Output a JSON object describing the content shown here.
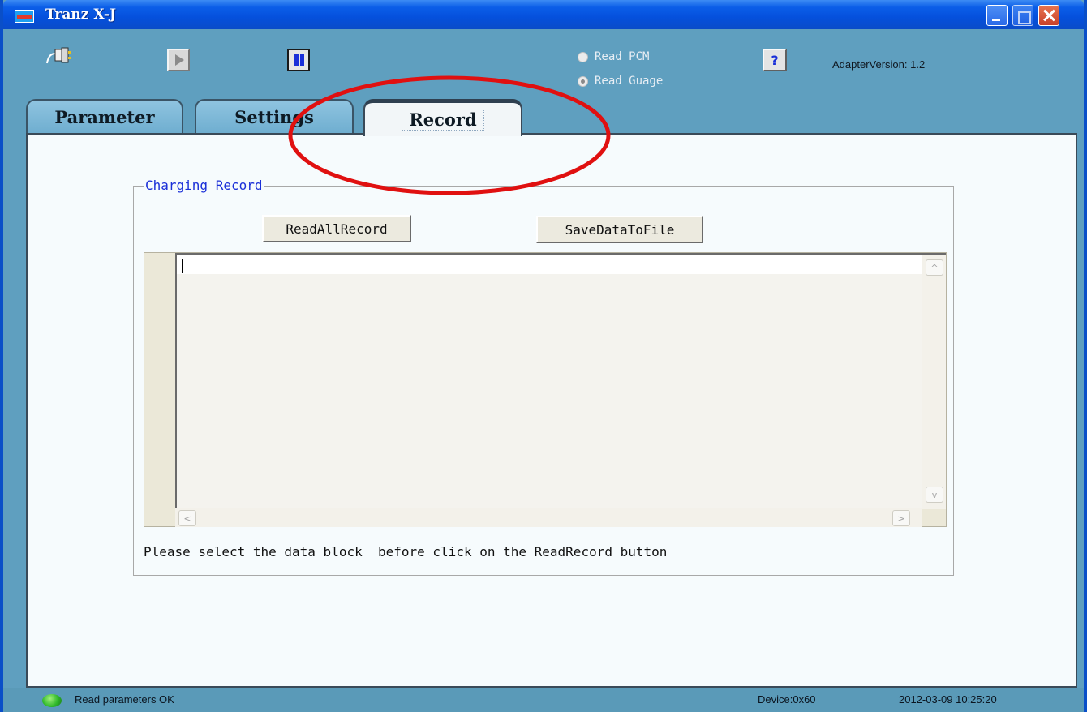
{
  "window": {
    "title": "Tranz X-J"
  },
  "toolbar": {
    "connect_icon": "connect-plug-icon",
    "play_icon": "play-icon",
    "pause_icon": "pause-icon",
    "help_icon": "help-cursor-icon",
    "help_label": "?",
    "read_pcm_label": "Read PCM",
    "read_guage_label": "Read Guage",
    "selected_mode": "Read Guage",
    "adapter_version": "AdapterVersion: 1.2"
  },
  "tabs": [
    {
      "label": "Parameter",
      "active": false
    },
    {
      "label": "Settings",
      "active": false
    },
    {
      "label": "Record",
      "active": true
    }
  ],
  "record": {
    "group_title": "Charging Record",
    "read_all_button": "ReadAllRecord",
    "save_button": "SaveDataToFile",
    "editor_value": "",
    "hint": "Please select the data block  before click on the ReadRecord button"
  },
  "scroll": {
    "up": "^",
    "down": "v",
    "left": "<",
    "right": ">"
  },
  "status": {
    "message": "Read parameters OK",
    "device": "Device:0x60",
    "timestamp": "2012-03-09 10:25:20"
  },
  "colors": {
    "titlebar": "#0550dc",
    "window_bg": "#5f9fbf",
    "group_title": "#1a2fd8",
    "annotation": "#e01010",
    "status_led": "#2fb82a"
  }
}
